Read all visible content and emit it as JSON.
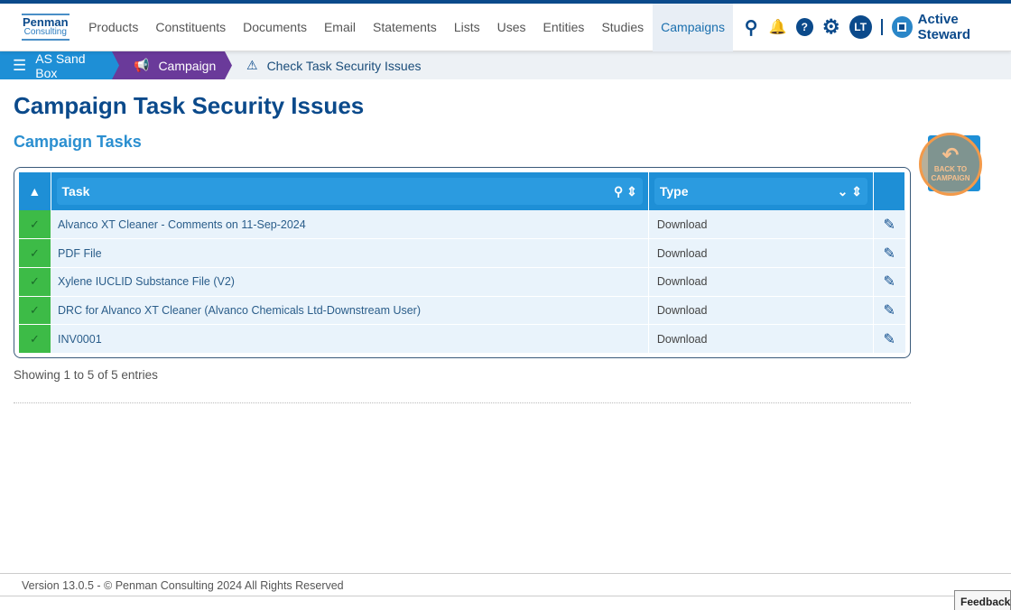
{
  "logo": {
    "line1": "Penman",
    "line2": "Consulting"
  },
  "nav": {
    "items": [
      "Products",
      "Constituents",
      "Documents",
      "Email",
      "Statements",
      "Lists",
      "Uses",
      "Entities",
      "Studies",
      "Campaigns"
    ],
    "active": "Campaigns",
    "avatar": "LT",
    "brand": "Active Steward"
  },
  "breadcrumb": {
    "home": "AS Sand Box",
    "campaign": "Campaign",
    "current": "Check Task Security Issues"
  },
  "page": {
    "title": "Campaign Task Security Issues",
    "subtitle": "Campaign Tasks",
    "back_button": "BACK TO CAMPAIGN"
  },
  "table": {
    "columns": [
      "Task",
      "Type"
    ],
    "rows": [
      {
        "task": "Alvanco XT Cleaner - Comments on 11-Sep-2024",
        "type": "Download"
      },
      {
        "task": "PDF File",
        "type": "Download"
      },
      {
        "task": "Xylene IUCLID Substance File (V2)",
        "type": "Download"
      },
      {
        "task": "DRC for Alvanco XT Cleaner (Alvanco Chemicals Ltd-Downstream User)",
        "type": "Download"
      },
      {
        "task": "INV0001",
        "type": "Download"
      }
    ]
  },
  "info": "Showing 1 to 5 of 5 entries",
  "footer": "Version 13.0.5 - © Penman Consulting 2024 All Rights Reserved",
  "feedback": "Feedback"
}
